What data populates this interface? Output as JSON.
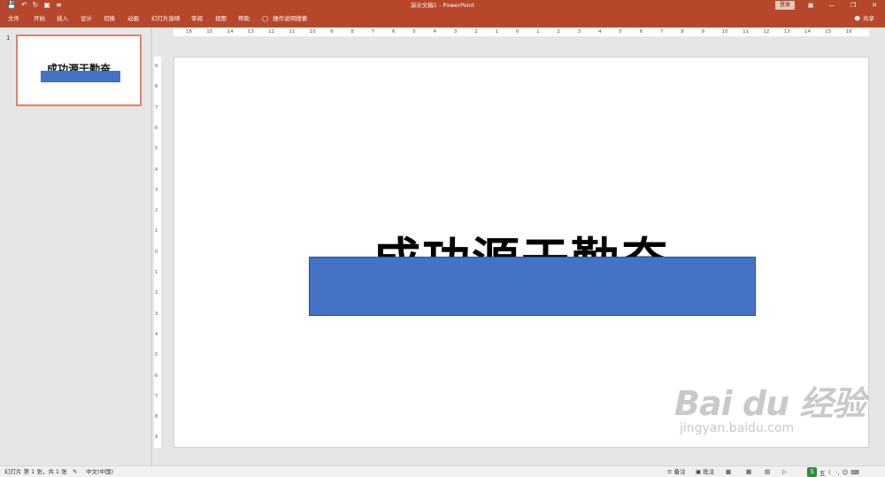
{
  "window": {
    "title": "演示文稿1  -  PowerPoint",
    "login": "登录"
  },
  "ribbon": {
    "tabs": [
      "文件",
      "开始",
      "插入",
      "设计",
      "切换",
      "动画",
      "幻灯片放映",
      "审阅",
      "视图",
      "帮助"
    ],
    "tell_me": "操作说明搜索",
    "share": "共享"
  },
  "thumbnails": [
    {
      "number": "1",
      "text": "成功源于勤奋"
    }
  ],
  "ruler": {
    "horizontal": [
      "16",
      "15",
      "14",
      "13",
      "12",
      "11",
      "10",
      "9",
      "8",
      "7",
      "6",
      "5",
      "4",
      "3",
      "2",
      "1",
      "0",
      "1",
      "2",
      "3",
      "4",
      "5",
      "6",
      "7",
      "8",
      "9",
      "10",
      "11",
      "12",
      "13",
      "14",
      "15",
      "16"
    ],
    "vertical": [
      "9",
      "8",
      "7",
      "6",
      "5",
      "4",
      "3",
      "2",
      "1",
      "0",
      "1",
      "2",
      "3",
      "4",
      "5",
      "6",
      "7",
      "8",
      "9"
    ]
  },
  "slide": {
    "title_text": "成功源于勤奋",
    "rect_color": "#4472c4"
  },
  "status": {
    "slide_info": "幻灯片 第 1 张，共 1 张",
    "language": "中文(中国)",
    "notes": "备注",
    "comments": "批注"
  },
  "watermark": {
    "main": "Bai du 经验",
    "sub": "jingyan.baidu.com"
  },
  "ime": {
    "label": "五"
  },
  "colors": {
    "accent": "#b7472a",
    "shape_fill": "#4472c4",
    "selection": "#e1816a"
  }
}
